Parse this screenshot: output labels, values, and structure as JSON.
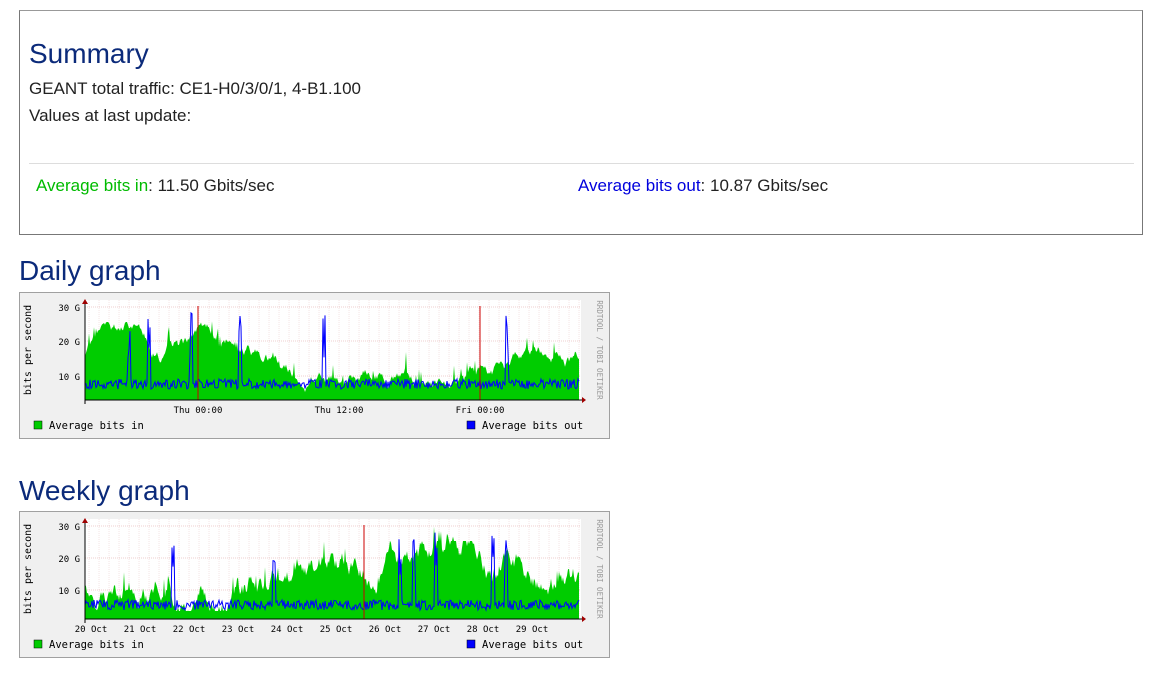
{
  "summary": {
    "title": "Summary",
    "line1": "GEANT total traffic: CE1-H0/3/0/1, 4-B1.100",
    "line2": "Values at last update:",
    "in_label": "Average bits in",
    "in_value": ": 11.50 Gbits/sec",
    "out_label": "Average bits out",
    "out_value": ": 10.87 Gbits/sec"
  },
  "daily": {
    "title": "Daily graph",
    "ylabel": "bits per second",
    "yticks": [
      "30 G",
      "20 G",
      "10 G"
    ],
    "xticks": [
      "Thu 00:00",
      "Thu 12:00",
      "Fri 00:00"
    ],
    "legend_in": "Average bits in",
    "legend_out": "Average bits out",
    "watermark": "RRDTOOL / TOBI OETIKER"
  },
  "weekly": {
    "title": "Weekly graph",
    "ylabel": "bits per second",
    "yticks": [
      "30 G",
      "20 G",
      "10 G"
    ],
    "xticks": [
      "20 Oct",
      "21 Oct",
      "22 Oct",
      "23 Oct",
      "24 Oct",
      "25 Oct",
      "26 Oct",
      "27 Oct",
      "28 Oct",
      "29 Oct"
    ],
    "legend_in": "Average bits in",
    "legend_out": "Average bits out",
    "watermark": "RRDTOOL / TOBI OETIKER"
  },
  "colors": {
    "in": "#00cc00",
    "out": "#0000ff",
    "title": "#0b2a7a",
    "marker": "#cc0000"
  }
}
